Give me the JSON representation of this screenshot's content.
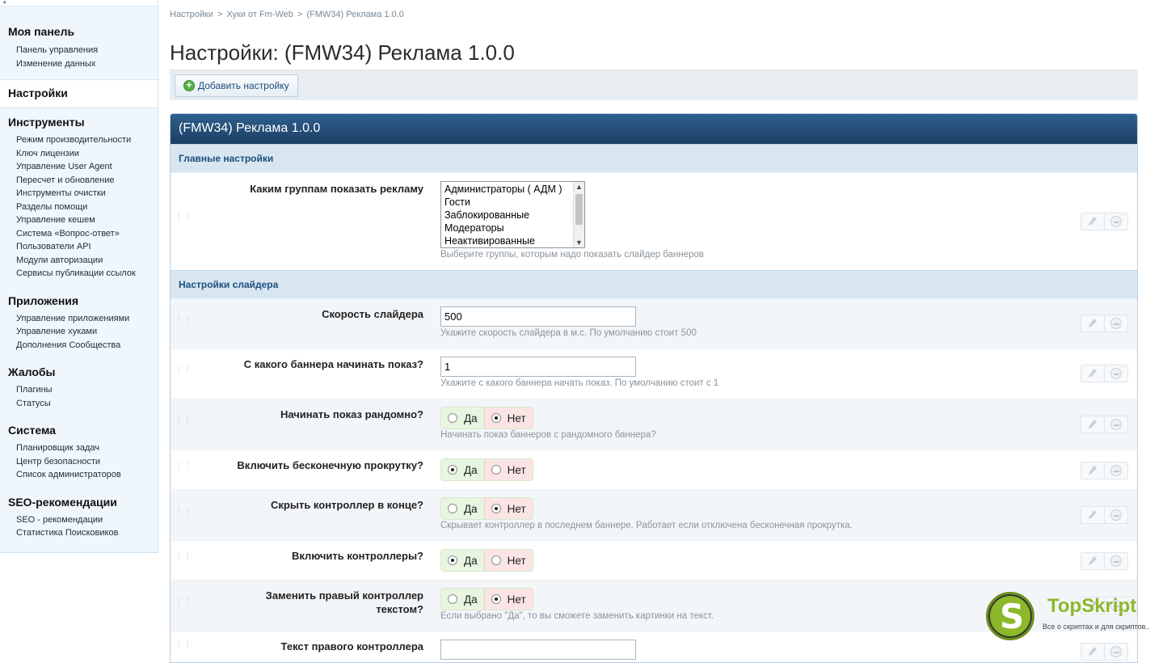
{
  "sidebar": {
    "collapse_arrow": "◂",
    "sections": [
      {
        "title": "Моя панель",
        "items": [
          "Панель управления",
          "Изменение данных"
        ]
      },
      {
        "title": "Настройки",
        "active": true
      },
      {
        "title": "Инструменты",
        "items": [
          "Режим производительности",
          "Ключ лицензии",
          "Управление User Agent",
          "Пересчет и обновление",
          "Инструменты очистки",
          "Разделы помощи",
          "Управление кешем",
          "Система «Вопрос-ответ»",
          "Пользователи API",
          "Модули авторизации",
          "Сервисы публикации ссылок"
        ]
      },
      {
        "title": "Приложения",
        "items": [
          "Управление приложениями",
          "Управление хуками",
          "Дополнения Сообщества"
        ]
      },
      {
        "title": "Жалобы",
        "items": [
          "Плагины",
          "Статусы"
        ]
      },
      {
        "title": "Система",
        "items": [
          "Планировщик задач",
          "Центр безопасности",
          "Список администраторов"
        ]
      },
      {
        "title": "SEO-рекомендации",
        "items": [
          "SEO - рекомендации",
          "Статистика Поисковиков"
        ]
      }
    ]
  },
  "breadcrumb": {
    "items": [
      "Настройки",
      "Хуки от Fm-Web",
      "(FMW34) Реклама 1.0.0"
    ],
    "sep": ">"
  },
  "page_title": "Настройки: (FMW34) Реклама 1.0.0",
  "toolbar": {
    "add_label": "Добавить настройку",
    "add_icon": "+"
  },
  "panel": {
    "title": "(FMW34) Реклама 1.0.0",
    "main_group": "Главные настройки",
    "groups_setting": {
      "label": "Каким группам показать рекламу",
      "options": [
        "Администраторы ( АДМ )",
        "Гости",
        "Заблокированные",
        "Модераторы",
        "Неактивированные"
      ],
      "hint": "Выберите группы, которым надо показать слайдер баннеров"
    },
    "slider_group": "Настройки слайдера",
    "speed": {
      "label": "Скорость слайдера",
      "value": "500",
      "hint": "Укажите скорость слайдера в м.с. По умолчанию стоит 500"
    },
    "start": {
      "label": "С какого баннера начинать показ?",
      "value": "1",
      "hint": "Укажите с какого баннера начать показ. По умолчанию стоит с 1"
    },
    "random": {
      "label": "Начинать показ рандомно?",
      "hint": "Начинать показ баннеров с рандомного баннера?"
    },
    "infinite": {
      "label": "Включить бесконечную прокрутку?"
    },
    "hide_ctrl": {
      "label": "Скрыть контроллер в конце?",
      "hint": "Скрывает контроллер в последнем баннере. Работает если отключена бесконечная прокрутка."
    },
    "enable_ctrl": {
      "label": "Включить контроллеры?"
    },
    "replace_ctrl": {
      "label_1": "Заменить правый контроллер",
      "label_2": "текстом?",
      "hint": "Если выбрано \"Да\", то вы сможете заменить картинки на текст."
    },
    "right_text": {
      "label": "Текст правого контроллера"
    },
    "yes": "Да",
    "no": "Нет",
    "grip": "⋮⋮"
  },
  "logo": {
    "letter": "S",
    "name": "TopSkript",
    "tagline": "Все о скриптах и для скриптов..."
  }
}
